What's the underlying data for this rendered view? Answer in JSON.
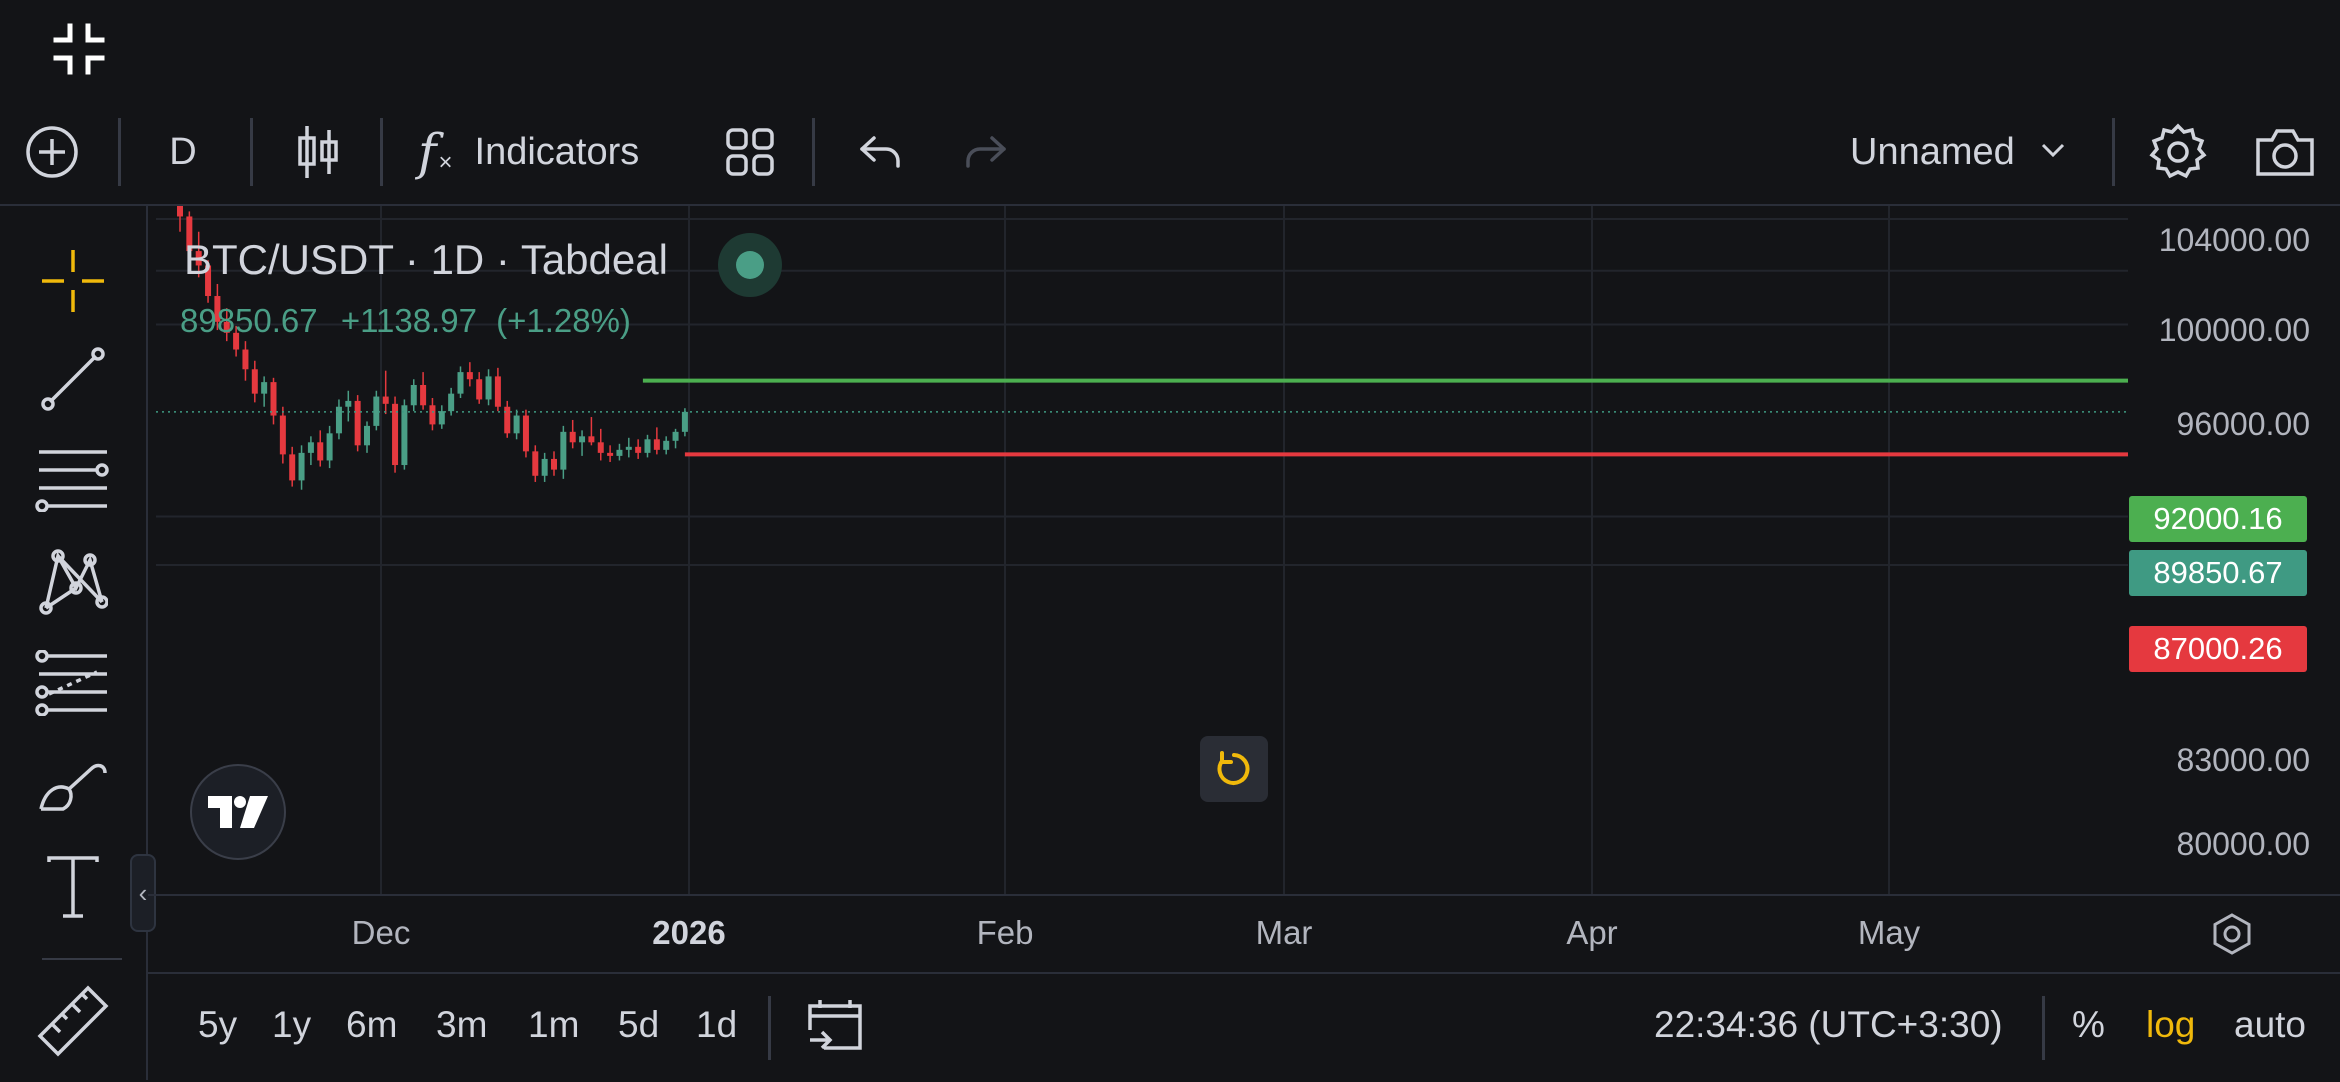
{
  "toolbar": {
    "interval": "D",
    "indicators_label": "Indicators",
    "layout_name": "Unnamed"
  },
  "legend": {
    "title": "BTC/USDT · 1D · Tabdeal",
    "last": "89850.67",
    "change": "+1138.97",
    "change_pct": "(+1.28%)"
  },
  "price_axis": {
    "labels": [
      "104000.00",
      "100000.00",
      "96000.00",
      "83000.00",
      "80000.00"
    ],
    "tags": [
      {
        "label": "92000.16",
        "color": "#4caf50"
      },
      {
        "label": "89850.67",
        "color": "#3f9a83"
      },
      {
        "label": "87000.26",
        "color": "#e5393f"
      }
    ]
  },
  "time_axis": {
    "labels": [
      "Dec",
      "2026",
      "Feb",
      "Mar",
      "Apr",
      "May"
    ]
  },
  "bottom": {
    "ranges": [
      "5y",
      "1y",
      "6m",
      "3m",
      "1m",
      "5d",
      "1d"
    ],
    "clock": "22:34:36 (UTC+3:30)",
    "percent": "%",
    "log": "log",
    "auto": "auto"
  },
  "colors": {
    "up": "#4a9e86",
    "down": "#e5393f",
    "accent": "#f0b90b",
    "background": "#131417"
  },
  "chart_data": {
    "type": "candlestick",
    "symbol": "BTC/USDT",
    "interval": "1D",
    "exchange": "Tabdeal",
    "x_labels": [
      "Dec",
      "2026",
      "Feb",
      "Mar",
      "Apr",
      "May"
    ],
    "y_ticks": [
      80000,
      83000,
      96000,
      100000,
      104000
    ],
    "last_price": 89850.67,
    "horizontal_lines": [
      92000.16,
      87000.26
    ],
    "scale": "log",
    "ohlc": [
      [
        105200,
        105800,
        103000,
        104200
      ],
      [
        104200,
        104600,
        101000,
        101500
      ],
      [
        101500,
        103000,
        99500,
        100400
      ],
      [
        100400,
        100800,
        97600,
        98100
      ],
      [
        98100,
        99000,
        95600,
        96200
      ],
      [
        96200,
        97200,
        94800,
        95400
      ],
      [
        95400,
        95900,
        93700,
        94200
      ],
      [
        94200,
        94800,
        92000,
        92800
      ],
      [
        92800,
        93400,
        90500,
        91100
      ],
      [
        91100,
        92300,
        90200,
        91900
      ],
      [
        91900,
        92200,
        89000,
        89600
      ],
      [
        89600,
        90200,
        86400,
        87000
      ],
      [
        87000,
        87500,
        84900,
        85300
      ],
      [
        85300,
        87600,
        84700,
        87100
      ],
      [
        87100,
        88200,
        86300,
        87800
      ],
      [
        87800,
        88600,
        86200,
        86600
      ],
      [
        86600,
        88900,
        86100,
        88400
      ],
      [
        88400,
        90700,
        88000,
        90200
      ],
      [
        90200,
        91300,
        89200,
        90600
      ],
      [
        90600,
        91000,
        87200,
        87600
      ],
      [
        87600,
        89200,
        87100,
        88900
      ],
      [
        88900,
        91300,
        88600,
        90900
      ],
      [
        90900,
        92700,
        89700,
        90400
      ],
      [
        90400,
        90900,
        85800,
        86300
      ],
      [
        86300,
        90700,
        86000,
        90300
      ],
      [
        90300,
        92100,
        89900,
        91700
      ],
      [
        91700,
        92600,
        90000,
        90300
      ],
      [
        90300,
        90800,
        88600,
        89000
      ],
      [
        89000,
        90300,
        88700,
        89900
      ],
      [
        89900,
        91500,
        89600,
        91100
      ],
      [
        91100,
        93000,
        90800,
        92600
      ],
      [
        92600,
        93300,
        91600,
        92100
      ],
      [
        92100,
        92600,
        90400,
        90700
      ],
      [
        90700,
        92800,
        90300,
        92300
      ],
      [
        92300,
        92900,
        89900,
        90200
      ],
      [
        90200,
        90600,
        88100,
        88400
      ],
      [
        88400,
        90000,
        88000,
        89600
      ],
      [
        89600,
        90000,
        86800,
        87200
      ],
      [
        87200,
        87600,
        85200,
        85600
      ],
      [
        85600,
        87100,
        85200,
        86700
      ],
      [
        86700,
        87200,
        85600,
        86000
      ],
      [
        86000,
        88900,
        85400,
        88500
      ],
      [
        88500,
        89300,
        87400,
        87800
      ],
      [
        87800,
        88600,
        86900,
        88200
      ],
      [
        88200,
        89500,
        87600,
        87800
      ],
      [
        87800,
        88700,
        86600,
        87100
      ],
      [
        87100,
        87600,
        86500,
        86900
      ],
      [
        86900,
        87700,
        86600,
        87300
      ],
      [
        87300,
        88100,
        86800,
        87500
      ],
      [
        87500,
        88000,
        86700,
        87100
      ],
      [
        87100,
        88300,
        86800,
        88000
      ],
      [
        88000,
        88800,
        87000,
        87300
      ],
      [
        87300,
        88200,
        87000,
        87900
      ],
      [
        87900,
        88700,
        87400,
        88500
      ],
      [
        88500,
        90100,
        88200,
        89850.67
      ]
    ]
  }
}
